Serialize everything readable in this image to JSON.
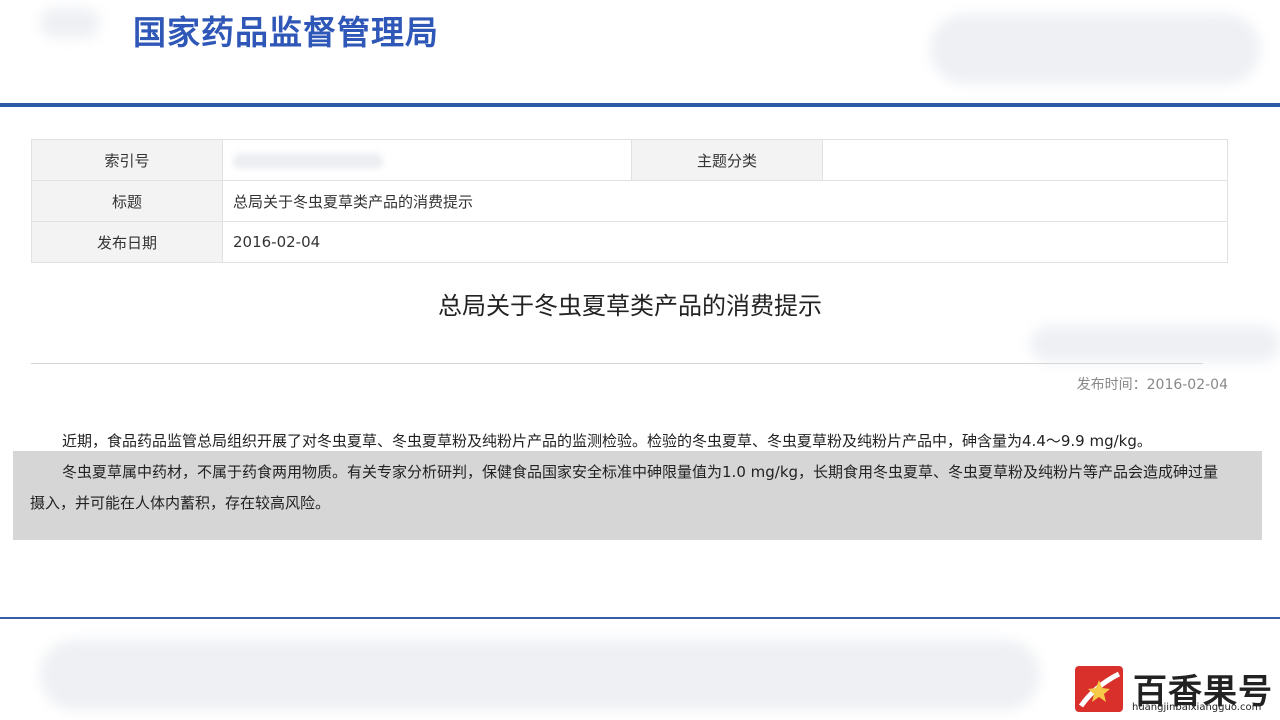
{
  "header": {
    "site_title": "国家药品监督管理局"
  },
  "meta": {
    "index_label": "索引号",
    "index_value": "",
    "category_label": "主题分类",
    "category_value": "",
    "title_label": "标题",
    "title_value": "总局关于冬虫夏草类产品的消费提示",
    "date_label": "发布日期",
    "date_value": "2016-02-04"
  },
  "article": {
    "title": "总局关于冬虫夏草类产品的消费提示",
    "publish_time": "发布时间：2016-02-04",
    "paragraphs": [
      "近期，食品药品监管总局组织开展了对冬虫夏草、冬虫夏草粉及纯粉片产品的监测检验。检验的冬虫夏草、冬虫夏草粉及纯粉片产品中，砷含量为4.4～9.9 mg/kg。",
      "冬虫夏草属中药材，不属于药食两用物质。有关专家分析研判，保健食品国家安全标准中砷限量值为1.0 mg/kg，长期食用冬虫夏草、冬虫夏草粉及纯粉片等产品会造成砷过量摄入，并可能在人体内蓄积，存在较高风险。"
    ]
  },
  "watermark": {
    "brand": "百香果号",
    "url": "huangjinbaixiangguo.com",
    "logo_icon": "star-logo-icon",
    "brand_color": "#d9302c"
  },
  "colors": {
    "accent_blue": "#2b59a8",
    "title_blue": "#2f57b7"
  }
}
